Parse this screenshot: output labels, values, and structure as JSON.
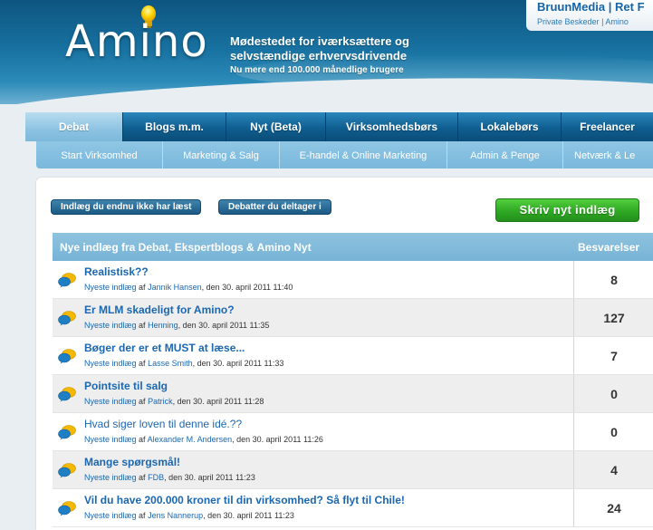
{
  "header": {
    "logo": "Amino",
    "tagline_line1": "Mødestedet for iværksættere og",
    "tagline_line2": "selvstændige erhvervsdrivende",
    "tagline_line3": "Nu mere end 100.000 månedlige brugere",
    "brand_left": "BruunMedia",
    "brand_sep": "|",
    "brand_right": "Ret F",
    "private_messages": "Private Beskeder",
    "small_sep": "|",
    "small_right": "Amino"
  },
  "main_nav": [
    {
      "label": "Debat",
      "active": true
    },
    {
      "label": "Blogs m.m.",
      "active": false
    },
    {
      "label": "Nyt (Beta)",
      "active": false
    },
    {
      "label": "Virksomhedsbørs",
      "active": false
    },
    {
      "label": "Lokalebørs",
      "active": false
    },
    {
      "label": "Freelancer",
      "active": false
    }
  ],
  "sub_nav": [
    "Start Virksomhed",
    "Marketing & Salg",
    "E-handel & Online Marketing",
    "Admin & Penge",
    "Netværk & Le"
  ],
  "actions": {
    "unread_button": "Indlæg du endnu ikke har læst",
    "participated_button": "Debatter du deltager i",
    "write_button": "Skriv nyt indlæg"
  },
  "table": {
    "title": "Nye indlæg fra Debat, Ekspertblogs & Amino Nyt",
    "replies_header": "Besvarelser",
    "meta_prefix": "Nyeste indlæg",
    "meta_by": "af",
    "rows": [
      {
        "title": "Realistisk??",
        "bold": true,
        "author": "Jannik Hansen",
        "date": ", den 30. april 2011 11:40",
        "replies": "8"
      },
      {
        "title": "Er MLM skadeligt for Amino?",
        "bold": true,
        "author": "Henning",
        "date": ", den 30. april 2011 11:35",
        "replies": "127"
      },
      {
        "title": "Bøger der er et MUST at læse...",
        "bold": true,
        "author": "Lasse Smith",
        "date": ", den 30. april 2011 11:33",
        "replies": "7"
      },
      {
        "title": "Pointsite til salg",
        "bold": true,
        "author": "Patrick",
        "date": ", den 30. april 2011 11:28",
        "replies": "0"
      },
      {
        "title": "Hvad siger loven til denne idé.??",
        "bold": false,
        "author": "Alexander M. Andersen",
        "date": ", den 30. april 2011 11:26",
        "replies": "0"
      },
      {
        "title": "Mange spørgsmål!",
        "bold": true,
        "author": "FDB",
        "date": ", den 30. april 2011 11:23",
        "replies": "4"
      },
      {
        "title": "Vil du have 200.000 kroner til din virksomhed? Så flyt til Chile!",
        "bold": true,
        "author": "Jens Nannerup",
        "date": ", den 30. april 2011 11:23",
        "replies": "24"
      }
    ]
  },
  "colors": {
    "header_blue": "#17709f",
    "link_blue": "#1b67b0",
    "green_button": "#2fa824",
    "table_head": "#77b3d6"
  },
  "icons": {
    "bulb": "lightbulb-icon",
    "thread": "chat-bubbles-icon"
  }
}
